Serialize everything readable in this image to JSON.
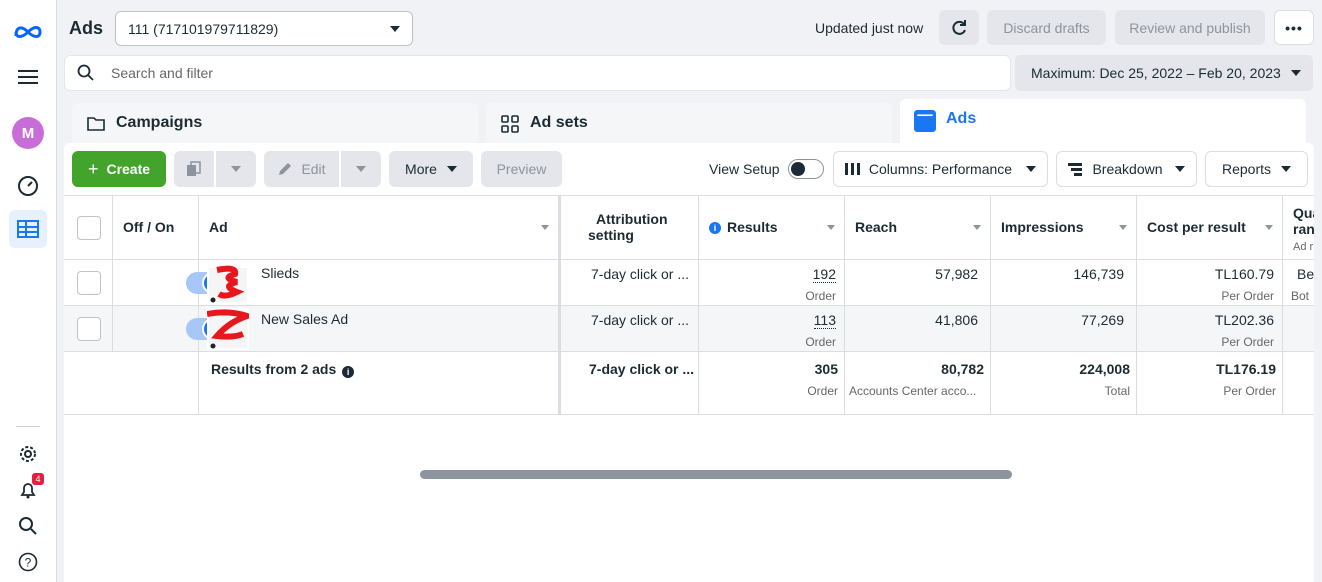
{
  "header": {
    "title": "Ads",
    "account": "111 (717101979711829)",
    "updated": "Updated just now",
    "discard": "Discard drafts",
    "review": "Review and publish"
  },
  "search": {
    "placeholder": "Search and filter"
  },
  "date_range": "Maximum: Dec 25, 2022 – Feb 20, 2023",
  "rail": {
    "avatar_letter": "M",
    "notification_count": "4"
  },
  "tabs": [
    {
      "label": "Campaigns"
    },
    {
      "label": "Ad sets"
    },
    {
      "label": "Ads"
    }
  ],
  "toolbar": {
    "create": "Create",
    "edit": "Edit",
    "more": "More",
    "preview": "Preview",
    "view_setup": "View Setup",
    "columns": "Columns: Performance",
    "breakdown": "Breakdown",
    "reports": "Reports"
  },
  "table": {
    "headers": {
      "off_on": "Off / On",
      "ad": "Ad",
      "attribution_1": "Attribution",
      "attribution_2": "setting",
      "results": "Results",
      "reach": "Reach",
      "impressions": "Impressions",
      "cost_per_result": "Cost per result",
      "quality_1": "Qua",
      "quality_2": "ran",
      "quality_3": "Ad r"
    },
    "rows": [
      {
        "ad": "Slieds",
        "attribution": "7-day click or ...",
        "results": "192",
        "results_sub": "Order",
        "reach": "57,982",
        "impressions": "146,739",
        "cost": "TL160.79",
        "cost_sub": "Per Order",
        "quality": "Be",
        "quality_sub": "Bot"
      },
      {
        "ad": "New Sales Ad",
        "attribution": "7-day click or ...",
        "results": "113",
        "results_sub": "Order",
        "reach": "41,806",
        "impressions": "77,269",
        "cost": "TL202.36",
        "cost_sub": "Per Order",
        "quality": "",
        "quality_sub": ""
      }
    ],
    "summary": {
      "label": "Results from 2 ads",
      "attribution": "7-day click or ...",
      "results": "305",
      "results_sub": "Order",
      "reach": "80,782",
      "reach_sub": "Accounts Center acco...",
      "impressions": "224,008",
      "impressions_sub": "Total",
      "cost": "TL176.19",
      "cost_sub": "Per Order"
    }
  },
  "colors": {
    "create": "#42a42b",
    "active_tab": "#1877f2",
    "toggle_on": "#1877f2"
  }
}
